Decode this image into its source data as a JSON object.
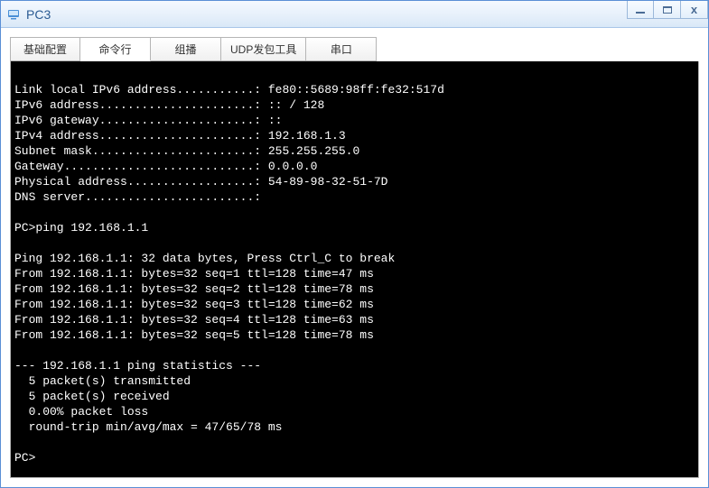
{
  "window": {
    "title": "PC3"
  },
  "tabs": [
    {
      "label": "基础配置",
      "active": false
    },
    {
      "label": "命令行",
      "active": true
    },
    {
      "label": "组播",
      "active": false
    },
    {
      "label": "UDP发包工具",
      "active": false
    },
    {
      "label": "串口",
      "active": false
    }
  ],
  "terminal": {
    "lines": [
      "",
      "Link local IPv6 address...........: fe80::5689:98ff:fe32:517d",
      "IPv6 address......................: :: / 128",
      "IPv6 gateway......................: ::",
      "IPv4 address......................: 192.168.1.3",
      "Subnet mask.......................: 255.255.255.0",
      "Gateway...........................: 0.0.0.0",
      "Physical address..................: 54-89-98-32-51-7D",
      "DNS server........................:",
      "",
      "PC>ping 192.168.1.1",
      "",
      "Ping 192.168.1.1: 32 data bytes, Press Ctrl_C to break",
      "From 192.168.1.1: bytes=32 seq=1 ttl=128 time=47 ms",
      "From 192.168.1.1: bytes=32 seq=2 ttl=128 time=78 ms",
      "From 192.168.1.1: bytes=32 seq=3 ttl=128 time=62 ms",
      "From 192.168.1.1: bytes=32 seq=4 ttl=128 time=63 ms",
      "From 192.168.1.1: bytes=32 seq=5 ttl=128 time=78 ms",
      "",
      "--- 192.168.1.1 ping statistics ---",
      "  5 packet(s) transmitted",
      "  5 packet(s) received",
      "  0.00% packet loss",
      "  round-trip min/avg/max = 47/65/78 ms",
      "",
      "PC>"
    ]
  }
}
